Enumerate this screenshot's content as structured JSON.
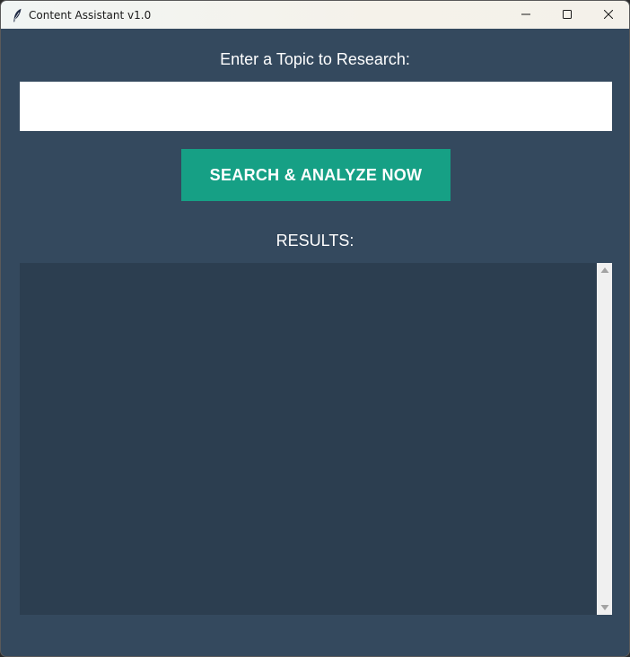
{
  "window": {
    "title": "Content Assistant v1.0",
    "icons": {
      "app": "feather-icon",
      "minimize": "minimize-icon",
      "maximize": "maximize-icon",
      "close": "close-icon"
    }
  },
  "form": {
    "topic_label": "Enter a Topic to Research:",
    "topic_value": "",
    "topic_placeholder": "",
    "search_button_label": "SEARCH & ANALYZE NOW"
  },
  "results": {
    "label": "RESULTS:",
    "text": ""
  },
  "colors": {
    "background": "#34495e",
    "results_background": "#2c3e50",
    "button": "#16a085",
    "button_text": "#ffffff",
    "label_text": "#ffffff"
  }
}
